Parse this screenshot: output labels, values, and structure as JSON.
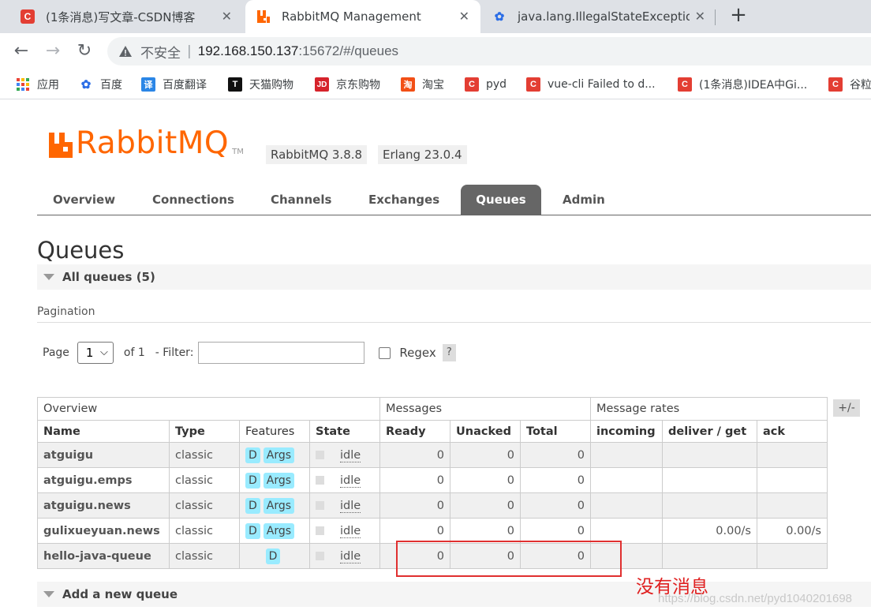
{
  "browser": {
    "tabs": [
      {
        "title": "(1条消息)写文章-CSDN博客",
        "icon": "csdn-icon",
        "active": false
      },
      {
        "title": "RabbitMQ Management",
        "icon": "rabbitmq-icon",
        "active": true
      },
      {
        "title": "java.lang.IllegalStateException",
        "icon": "baidu-paw-icon",
        "active": false
      }
    ],
    "new_tab": "+",
    "address": {
      "insecure_label": "不安全",
      "separator": "|",
      "host": "192.168.150.137",
      "rest": ":15672/#/queues"
    },
    "bookmarks": [
      {
        "label": "应用",
        "icon": "apps-grid-icon"
      },
      {
        "label": "百度",
        "icon": "baidu-paw-icon"
      },
      {
        "label": "百度翻译",
        "icon": "baidu-translate-icon"
      },
      {
        "label": "天猫购物",
        "icon": "tmall-icon"
      },
      {
        "label": "京东购物",
        "icon": "jd-icon"
      },
      {
        "label": "淘宝",
        "icon": "taobao-icon"
      },
      {
        "label": "pyd",
        "icon": "csdn-icon"
      },
      {
        "label": "vue-cli Failed to d...",
        "icon": "csdn-icon"
      },
      {
        "label": "(1条消息)IDEA中Gi...",
        "icon": "csdn-icon"
      },
      {
        "label": "谷粒",
        "icon": "csdn-icon"
      }
    ]
  },
  "header": {
    "logo_text": "RabbitMQ",
    "logo_tm": "TM",
    "rabbitmq_version": "RabbitMQ 3.8.8",
    "erlang_version": "Erlang 23.0.4"
  },
  "nav": {
    "tabs": [
      "Overview",
      "Connections",
      "Channels",
      "Exchanges",
      "Queues",
      "Admin"
    ],
    "active": "Queues"
  },
  "page": {
    "title": "Queues",
    "all_queues_label": "All queues (5)",
    "pagination_label": "Pagination",
    "page_label": "Page",
    "page_value": "1",
    "of_label": "of 1",
    "filter_label": "- Filter:",
    "filter_value": "",
    "regex_label": "Regex",
    "help_label": "?",
    "plus_minus": "+/-",
    "add_queue_label": "Add a new queue"
  },
  "table": {
    "group_headers": [
      "Overview",
      "Messages",
      "Message rates"
    ],
    "columns": [
      "Name",
      "Type",
      "Features",
      "State",
      "Ready",
      "Unacked",
      "Total",
      "incoming",
      "deliver / get",
      "ack"
    ],
    "rows": [
      {
        "name": "atguigu",
        "type": "classic",
        "features": [
          "D",
          "Args"
        ],
        "state": "idle",
        "ready": "0",
        "unacked": "0",
        "total": "0",
        "incoming": "",
        "deliver_get": "",
        "ack": ""
      },
      {
        "name": "atguigu.emps",
        "type": "classic",
        "features": [
          "D",
          "Args"
        ],
        "state": "idle",
        "ready": "0",
        "unacked": "0",
        "total": "0",
        "incoming": "",
        "deliver_get": "",
        "ack": ""
      },
      {
        "name": "atguigu.news",
        "type": "classic",
        "features": [
          "D",
          "Args"
        ],
        "state": "idle",
        "ready": "0",
        "unacked": "0",
        "total": "0",
        "incoming": "",
        "deliver_get": "",
        "ack": ""
      },
      {
        "name": "gulixueyuan.news",
        "type": "classic",
        "features": [
          "D",
          "Args"
        ],
        "state": "idle",
        "ready": "0",
        "unacked": "0",
        "total": "0",
        "incoming": "",
        "deliver_get": "0.00/s",
        "ack": "0.00/s"
      },
      {
        "name": "hello-java-queue",
        "type": "classic",
        "features": [
          "D"
        ],
        "state": "idle",
        "ready": "0",
        "unacked": "0",
        "total": "0",
        "incoming": "",
        "deliver_get": "",
        "ack": ""
      }
    ]
  },
  "annotation": {
    "text": "没有消息",
    "color": "#e02020"
  },
  "watermark": "https://blog.csdn.net/pyd1040201698",
  "colors": {
    "rabbit_orange": "#ff6600",
    "feature_badge": "#99ebff",
    "nav_active": "#666666"
  }
}
